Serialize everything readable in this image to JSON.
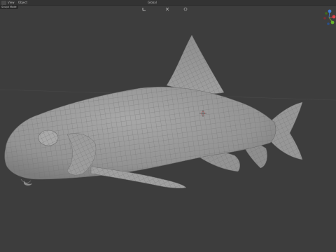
{
  "header": {
    "menus": [
      "View",
      "Object"
    ],
    "shading": "Global",
    "mode": "Sculpt Mode"
  },
  "colors": {
    "viewport_bg": "#3d3d3d",
    "header_bg": "#333333",
    "mesh_fill": "#9a9a9a",
    "wire": "#6f6f6f",
    "gizmo_x": "#e0444e",
    "gizmo_y": "#6ab12a",
    "gizmo_z": "#3d7cd6"
  },
  "icons": [
    "view3d-icon",
    "transform-orientation-icon",
    "snap-icon",
    "proportional-edit-icon",
    "navigation-gizmo-icon"
  ]
}
